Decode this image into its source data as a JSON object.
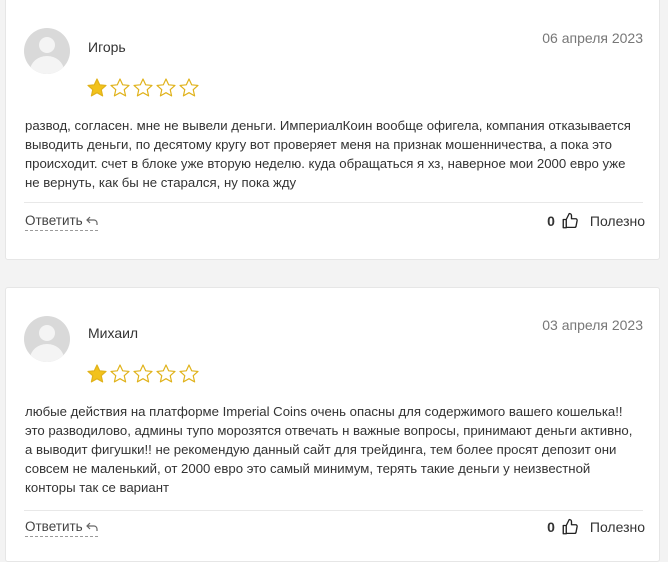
{
  "reviews": [
    {
      "author": "Игорь",
      "date": "06 апреля 2023",
      "rating": 1,
      "max_rating": 5,
      "text": "развод, согласен. мне не вывели деньги. ИмпериалКоин вообще офигела, компания отказывается выводить деньги, по десятому кругу вот проверяет меня на признак мошенничества, а пока это происходит. счет в блоке уже вторую неделю. куда обращаться я хз, наверное мои 2000 евро уже не вернуть, как бы не старался, ну пока жду",
      "reply_label": "Ответить",
      "likes": "0",
      "useful_label": "Полезно"
    },
    {
      "author": "Михаил",
      "date": "03 апреля 2023",
      "rating": 1,
      "max_rating": 5,
      "text": "любые действия на платформе Imperial Coins очень опасны для содержимого вашего кошелька!! это разводилово, админы тупо морозятся отвечать н важные вопросы, принимают деньги активно, а выводит фигушки!! не рекомендую данный сайт для трейдинга, тем более просят депозит они совсем не маленький, от 2000 евро это самый минимум, терять такие деньги у неизвестной конторы так се вариант",
      "reply_label": "Ответить",
      "likes": "0",
      "useful_label": "Полезно"
    }
  ],
  "colors": {
    "star_fill": "#F2C21B",
    "star_outline": "#E0B21A",
    "avatar": "#D9D9D9"
  }
}
